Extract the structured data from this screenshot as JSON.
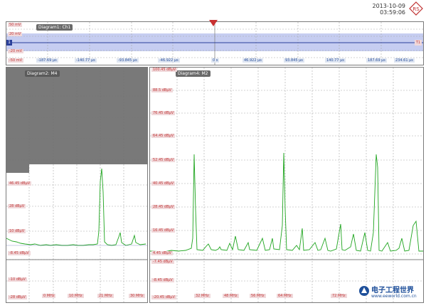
{
  "timestamp": {
    "date": "2013-10-09",
    "time": "03:59:06"
  },
  "logo": {
    "icon": "rohde-schwarz-logo",
    "text": "RS"
  },
  "colors": {
    "trace_green": "#1fa51f",
    "trace_blue": "#2a3f9a",
    "band_blue": "#b9c4ef",
    "label_red": "#c23a3a"
  },
  "diagram1": {
    "title": "Diagram1: Ch1",
    "y_labels": [
      "50 mV",
      "20 mV",
      "-20 mV",
      "-50 mV"
    ],
    "x_labels": [
      "-187.69 µs",
      "-140.77 µs",
      "-93.845 µs",
      "-46.922 µs",
      "0 s",
      "46.922 µs",
      "93.845 µs",
      "140.77 µs",
      "187.69 µs",
      "234.61 µs"
    ],
    "ch_marker": "1",
    "ref_marker": "T1"
  },
  "diagram2": {
    "title": "Diagram2: M4",
    "y_labels": [
      "46.45 dBµV",
      "28 dBµV",
      "10 dBµV",
      "-8.45 dBµV",
      "-10 dBµV",
      "-28 dBµV"
    ],
    "x_labels": [
      "0 MHz",
      "10 MHz",
      "21 MHz",
      "30 MHz"
    ]
  },
  "diagram4": {
    "title": "Diagram4: M2",
    "y_labels": [
      "100.45 dBµV",
      "88.5 dBµV",
      "76.45 dBµV",
      "64.45 dBµV",
      "52.45 dBµV",
      "40.45 dBµV",
      "28.45 dBµV",
      "16.45 dBµV",
      "4.45 dBµV",
      "-7.45 dBµV",
      "-8.45 dBµV",
      "-20.45 dBµV"
    ],
    "x_labels": [
      "32 MHz",
      "48 MHz",
      "56 MHz",
      "64 MHz",
      "72 MHz"
    ]
  },
  "watermark": {
    "cn": "电子工程世界",
    "url": "www.eeworld.com.cn"
  }
}
